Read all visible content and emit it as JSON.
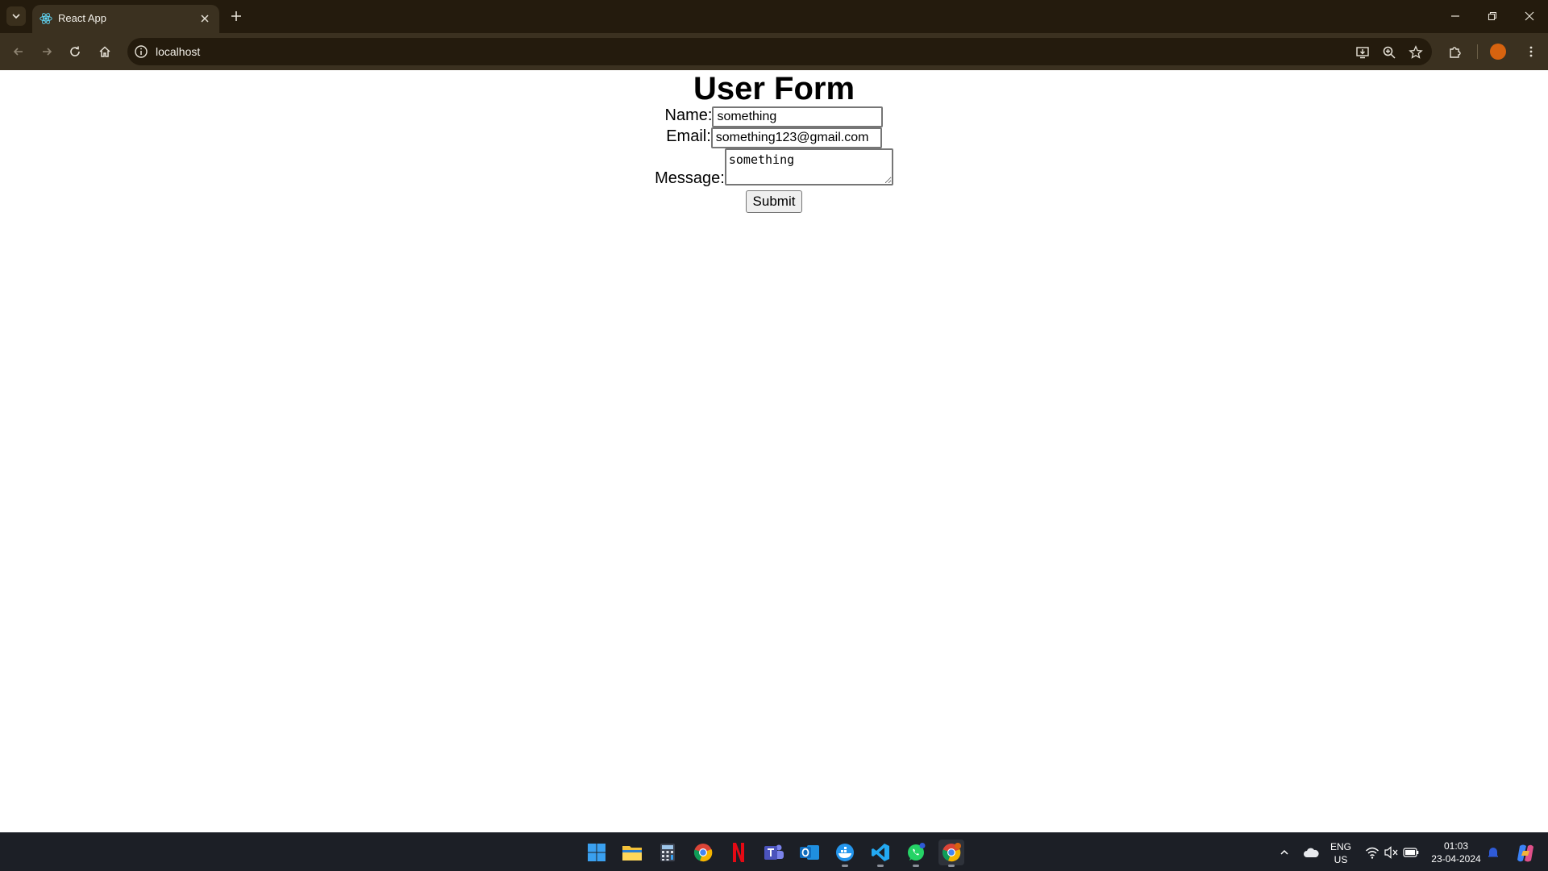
{
  "browser": {
    "tab": {
      "title": "React App"
    },
    "address_bar": {
      "url": "localhost"
    }
  },
  "page": {
    "heading": "User Form",
    "form": {
      "name_label": "Name:",
      "name_value": "something",
      "email_label": "Email:",
      "email_value": "something123@gmail.com",
      "message_label": "Message:",
      "message_value": "something",
      "submit_label": "Submit"
    }
  },
  "taskbar": {
    "apps": [
      "windows-start",
      "file-explorer",
      "calculator",
      "chrome",
      "netflix",
      "teams",
      "outlook",
      "docker",
      "vscode",
      "whatsapp",
      "chrome-profile"
    ],
    "tray": {
      "language_line1": "ENG",
      "language_line2": "US",
      "time": "01:03",
      "date": "23-04-2024"
    }
  },
  "colors": {
    "chrome_dark": "#241b0d",
    "chrome_toolbar": "#3b3120",
    "profile_avatar": "#d7630f",
    "taskbar": "#1c1f26"
  }
}
